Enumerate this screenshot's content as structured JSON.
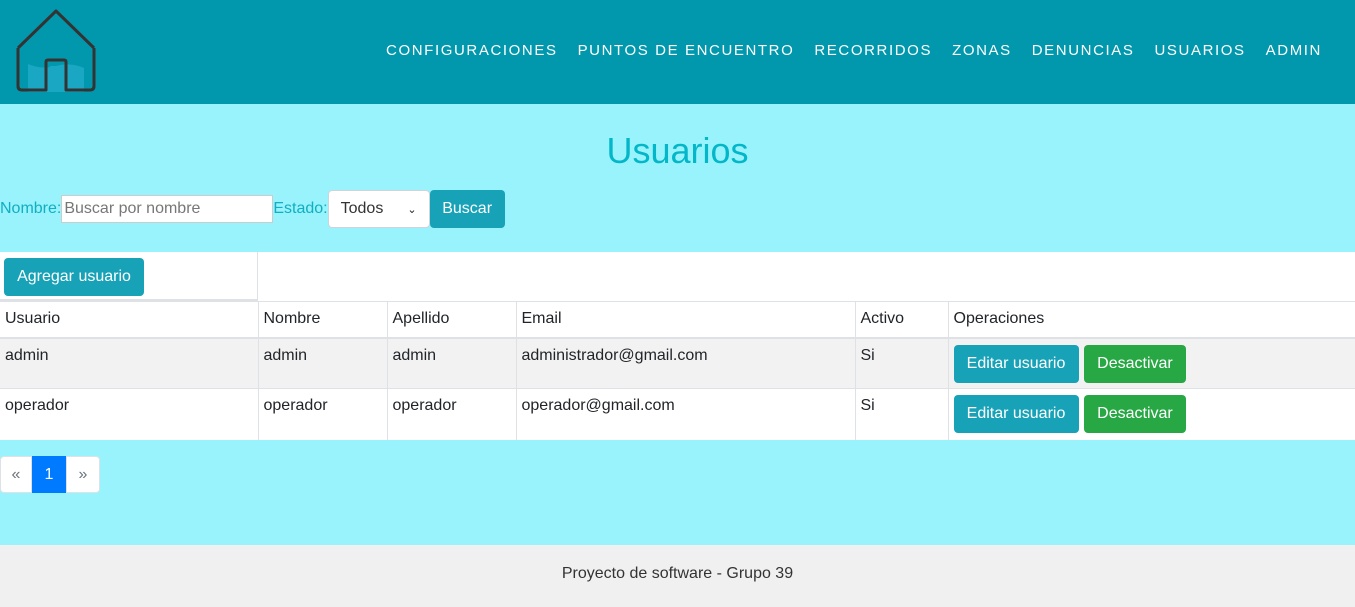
{
  "nav": {
    "items": [
      "CONFIGURACIONES",
      "PUNTOS DE ENCUENTRO",
      "RECORRIDOS",
      "ZONAS",
      "DENUNCIAS",
      "USUARIOS",
      "ADMIN"
    ]
  },
  "page": {
    "title": "Usuarios"
  },
  "filters": {
    "name_label": "Nombre:",
    "name_value": "",
    "name_placeholder": "Buscar por nombre",
    "estado_label": "Estado:",
    "estado_selected": "Todos",
    "search_button": "Buscar"
  },
  "table": {
    "add_button": "Agregar usuario",
    "columns": [
      "Usuario",
      "Nombre",
      "Apellido",
      "Email",
      "Activo",
      "Operaciones"
    ],
    "rows": [
      {
        "usuario": "admin",
        "nombre": "admin",
        "apellido": "admin",
        "email": "administrador@gmail.com",
        "activo": "Si",
        "edit_label": "Editar usuario",
        "toggle_label": "Desactivar"
      },
      {
        "usuario": "operador",
        "nombre": "operador",
        "apellido": "operador",
        "email": "operador@gmail.com",
        "activo": "Si",
        "edit_label": "Editar usuario",
        "toggle_label": "Desactivar"
      }
    ]
  },
  "pagination": {
    "prev": "«",
    "current": "1",
    "next": "»"
  },
  "footer": {
    "text": "Proyecto de software - Grupo 39"
  },
  "colors": {
    "navbar": "#0198ad",
    "page_background": "#98f3fc",
    "title": "#03b6c8",
    "info_button": "#17a2b8",
    "success_button": "#28a745",
    "page_active": "#007bff"
  },
  "icons": {
    "logo": "house-icon"
  }
}
